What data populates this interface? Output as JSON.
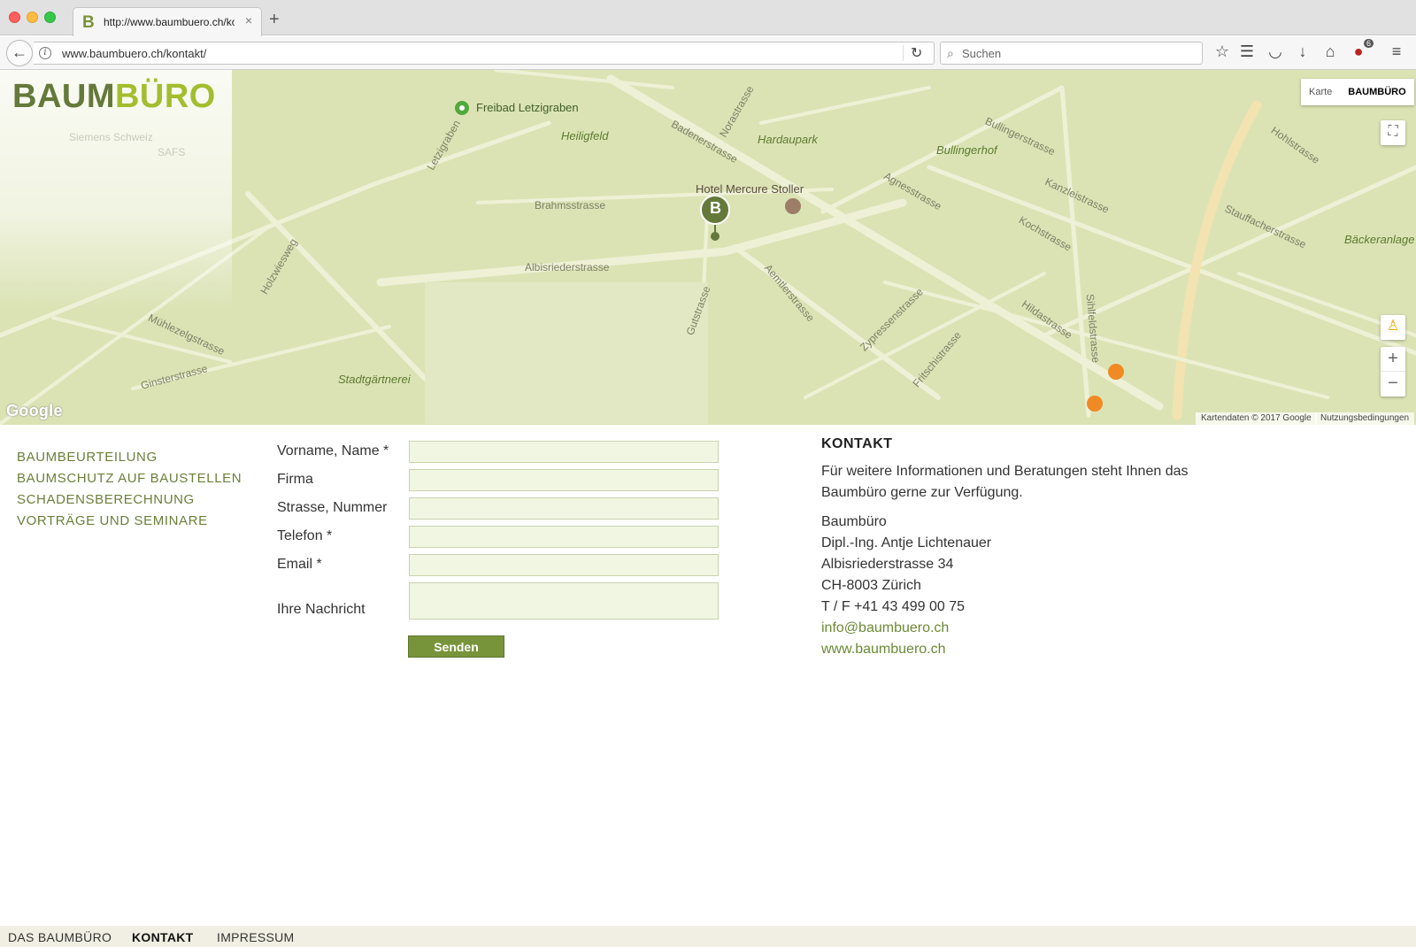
{
  "browser": {
    "tab_favicon": "B",
    "tab_title": "http://www.baumbuero.ch/kontakt/",
    "tab_close": "×",
    "new_tab": "+",
    "url": "www.baumbuero.ch/kontakt/",
    "search_placeholder": "Suchen",
    "badge_count": "6"
  },
  "map": {
    "logo_part1": "BAUM",
    "logo_part2": "BÜRO",
    "marker_letter": "B",
    "map_type_options": [
      "Karte",
      "BAUMBÜRO"
    ],
    "labels": [
      {
        "text": "Freibad Letzigraben",
        "kind": "poi"
      },
      {
        "text": "Heiligfeld",
        "kind": "park"
      },
      {
        "text": "Hardaupark",
        "kind": "park"
      },
      {
        "text": "Bullingerhof",
        "kind": "park"
      },
      {
        "text": "Hotel Mercure Stoller",
        "kind": "hotel"
      },
      {
        "text": "Brahmsstrasse",
        "kind": "street"
      },
      {
        "text": "Albisriederstrasse",
        "kind": "street"
      },
      {
        "text": "Badenerstrasse",
        "kind": "street"
      },
      {
        "text": "Stadtgärtnerei",
        "kind": "park"
      },
      {
        "text": "Bäckeranlage",
        "kind": "park"
      },
      {
        "text": "Siemens Schweiz",
        "kind": "street"
      },
      {
        "text": "SAFS",
        "kind": "street"
      },
      {
        "text": "Letzigraben",
        "kind": "street"
      },
      {
        "text": "Kanzleistrasse",
        "kind": "street"
      },
      {
        "text": "Stauffacherstrasse",
        "kind": "street"
      },
      {
        "text": "Agnesstrasse",
        "kind": "street"
      },
      {
        "text": "Kochstrasse",
        "kind": "street"
      },
      {
        "text": "Aemtlerstrasse",
        "kind": "street"
      },
      {
        "text": "Hohlstrasse",
        "kind": "street"
      },
      {
        "text": "Gutstrasse",
        "kind": "street"
      },
      {
        "text": "Mühlezelgstrasse",
        "kind": "street"
      },
      {
        "text": "Holzwiesweg",
        "kind": "street"
      },
      {
        "text": "Zypressenstrasse",
        "kind": "street"
      },
      {
        "text": "Hildastrasse",
        "kind": "street"
      },
      {
        "text": "Sihlfeldstrasse",
        "kind": "street"
      },
      {
        "text": "Fritschistrasse",
        "kind": "street"
      },
      {
        "text": "Bullingerstrasse",
        "kind": "street"
      },
      {
        "text": "Norastrasse",
        "kind": "street"
      },
      {
        "text": "Ginsterstrasse",
        "kind": "street"
      }
    ],
    "google_logo": "Google",
    "attribution": "Kartendaten © 2017 Google",
    "terms": "Nutzungsbedingungen",
    "zoom_in": "+",
    "zoom_out": "−"
  },
  "nav": [
    "BAUMBEURTEILUNG",
    "BAUMSCHUTZ AUF BAUSTELLEN",
    "SCHADENSBERECHNUNG",
    "VORTRÄGE UND SEMINARE"
  ],
  "form": {
    "labels": [
      "Vorname, Name *",
      "Firma",
      "Strasse, Nummer",
      "Telefon *",
      "Email *",
      "Ihre Nachricht"
    ],
    "submit": "Senden"
  },
  "contact": {
    "heading": "KONTAKT",
    "intro": "Für weitere Informationen und Beratungen steht Ihnen das Baumbüro gerne zur Verfügung.",
    "address": [
      "Baumbüro",
      "Dipl.-Ing. Antje Lichtenauer",
      "Albisriederstrasse 34",
      "CH-8003 Zürich",
      "T / F +41 43 499 00 75"
    ],
    "email": "info@baumbuero.ch",
    "web": "www.baumbuero.ch"
  },
  "footer": [
    "DAS BAUMBÜRO",
    "KONTAKT",
    "IMPRESSUM"
  ]
}
